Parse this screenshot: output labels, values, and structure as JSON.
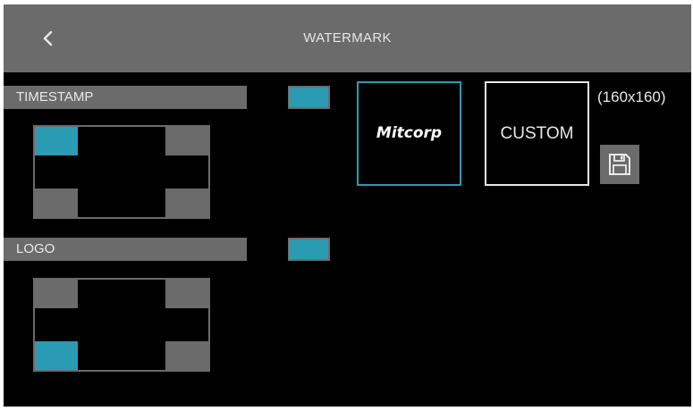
{
  "header": {
    "title": "WATERMARK",
    "back_icon": "chevron-left-icon"
  },
  "timestamp": {
    "label": "TIMESTAMP",
    "enabled": true,
    "selected_position": "top-left"
  },
  "logo": {
    "label": "LOGO",
    "enabled": true,
    "selected_position": "bottom-left"
  },
  "watermark_options": {
    "logo_text": "Mitcorp",
    "custom_label": "CUSTOM",
    "custom_size": "(160x160)",
    "selected": "logo",
    "save_icon": "floppy-disk-icon"
  },
  "colors": {
    "accent": "#2b9bb3",
    "bar": "#6b6b6b",
    "background": "#000000"
  }
}
